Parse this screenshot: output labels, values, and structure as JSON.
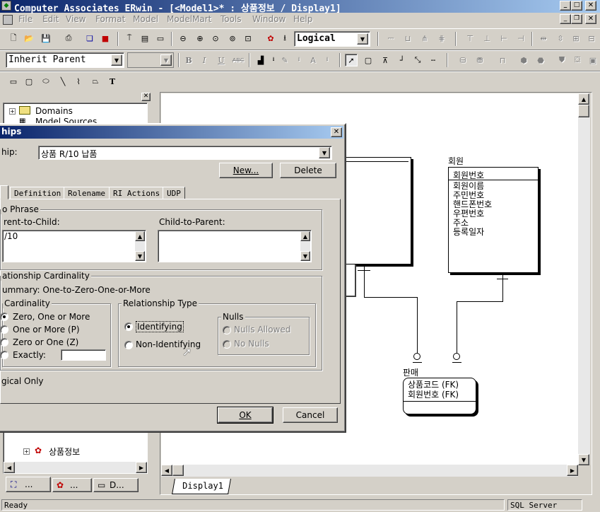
{
  "app": {
    "title": "Computer Associates ERwin - [<Model1>* : 상품정보 / Display1]",
    "menu": [
      "File",
      "Edit",
      "View",
      "Format",
      "Model",
      "ModelMart",
      "Tools",
      "Window",
      "Help"
    ]
  },
  "toolbar": {
    "view_combo": "Logical",
    "font_combo": "Inherit Parent",
    "size_combo": ""
  },
  "explorer": {
    "items": [
      "Domains",
      "Model Sources"
    ],
    "bottom_item": "상품정보",
    "tabs": [
      "...",
      "...",
      "D..."
    ]
  },
  "dialog": {
    "title_partial": "hips",
    "relationship_label": "hip:",
    "relationship_value": "상품 R/10 납품",
    "new_button": "New...",
    "delete_button": "Delete",
    "tabs": [
      "",
      "Definition",
      "Rolename",
      "RI Actions",
      "UDP"
    ],
    "verb_phrase": {
      "title": "o Phrase",
      "parent_to_child_label": "rent-to-Child:",
      "parent_to_child_value": "/10",
      "child_to_parent_label": "Child-to-Parent:",
      "child_to_parent_value": ""
    },
    "cardinality_group": {
      "title": "ationship Cardinality",
      "summary": "ummary: One-to-Zero-One-or-More",
      "cardinality_title": "Cardinality",
      "options": [
        "Zero, One or More",
        "One or More (P)",
        "Zero or One (Z)",
        "Exactly:"
      ],
      "exactly_value": ""
    },
    "relationship_type": {
      "title": "Relationship Type",
      "identifying": "Identifying",
      "non_identifying": "Non-Identifying"
    },
    "nulls": {
      "title": "Nulls",
      "nulls_allowed": "Nulls Allowed",
      "no_nulls": "No Nulls"
    },
    "logical_only": "gical Only",
    "ok_button": "OK",
    "cancel_button": "Cancel"
  },
  "diagram": {
    "entity_member": {
      "name": "회원",
      "key": "회원번호",
      "attributes": [
        "회원이름",
        "주민번호",
        "핸드폰번호",
        "우편번호",
        "주소",
        "등록일자"
      ]
    },
    "entity_sale": {
      "name": "판매",
      "keys": [
        "상품코드 (FK)",
        "회원번호 (FK)"
      ]
    },
    "tab_name": "Display1"
  },
  "status": {
    "left": "Ready",
    "right": "SQL Server"
  }
}
